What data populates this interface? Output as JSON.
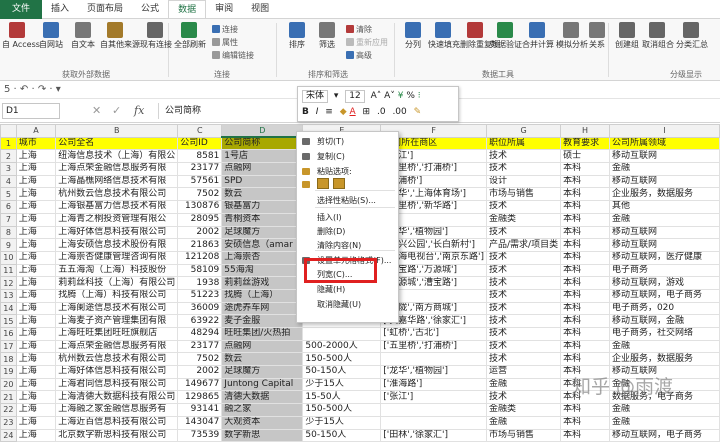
{
  "tabs": [
    "文件",
    "插入",
    "页面布局",
    "公式",
    "数据",
    "审阅",
    "视图"
  ],
  "ribbon": {
    "buttons": [
      {
        "label": "自 Access",
        "name": "from-access",
        "color": "#b33a3a"
      },
      {
        "label": "自网站",
        "name": "from-web",
        "color": "#3a6fb3"
      },
      {
        "label": "自文本",
        "name": "from-text",
        "color": "#777777"
      },
      {
        "label": "自其他来源",
        "name": "from-other",
        "color": "#a37a2a"
      },
      {
        "label": "现有连接",
        "name": "existing-connections",
        "color": "#666666"
      },
      {
        "label": "全部刷新",
        "name": "refresh-all",
        "color": "#2a8a4a"
      },
      {
        "label": "排序",
        "name": "sort",
        "color": "#3a6fb3"
      },
      {
        "label": "筛选",
        "name": "filter",
        "color": "#777777"
      },
      {
        "label": "分列",
        "name": "text-to-columns",
        "color": "#3a6fb3"
      },
      {
        "label": "快速填充",
        "name": "flash-fill",
        "color": "#3a6fb3"
      },
      {
        "label": "删除重复项",
        "name": "remove-duplicates",
        "color": "#b33a3a"
      },
      {
        "label": "数据验证",
        "name": "data-validation",
        "color": "#2a8a4a"
      },
      {
        "label": "合并计算",
        "name": "consolidate",
        "color": "#3a6fb3"
      },
      {
        "label": "模拟分析",
        "name": "what-if",
        "color": "#777777"
      },
      {
        "label": "关系",
        "name": "relationships",
        "color": "#777777"
      },
      {
        "label": "创建组",
        "name": "group",
        "color": "#666666"
      },
      {
        "label": "取消组合",
        "name": "ungroup",
        "color": "#666666"
      },
      {
        "label": "分类汇总",
        "name": "subtotal",
        "color": "#666666"
      }
    ],
    "small": [
      "连接",
      "属性",
      "编辑链接",
      "清除",
      "重新应用",
      "高级"
    ],
    "groups": [
      "获取外部数据",
      "连接",
      "排序和筛选",
      "数据工具",
      "分级显示"
    ]
  },
  "quick_access": "5 · ↶ · ↷ · ▾",
  "formula_bar": {
    "name_box": "D1",
    "value": "公司简称"
  },
  "columns": [
    "A",
    "B",
    "C",
    "D",
    "E",
    "F",
    "G",
    "H",
    "I"
  ],
  "rows": [
    [
      "城市",
      "公司全名",
      "公司ID",
      "公司简称",
      "",
      "公司所在商区",
      "职位所属",
      "教育要求",
      "公司所属领域"
    ],
    [
      "上海",
      "纽海信息技术（上海）有限公",
      "8581",
      "1号店",
      "",
      "['张江']",
      "技术",
      "硕士",
      "移动互联网"
    ],
    [
      "上海",
      "上海点荣金融信息服务有限",
      "23177",
      "点融网",
      "",
      "['五里桥','打浦桥']",
      "技术",
      "本科",
      "金融"
    ],
    [
      "上海",
      "上海晶樵网络信息技术有限",
      "57561",
      "SPD",
      "",
      "['打浦桥']",
      "设计",
      "本科",
      "移动互联网"
    ],
    [
      "上海",
      "杭州数云信息技术有限公司",
      "7502",
      "数云",
      "",
      "['龙华','上海体育场']",
      "市场与销售",
      "本科",
      "企业服务，数据服务"
    ],
    [
      "上海",
      "上海银基富力信息技术有限",
      "130876",
      "银基富力",
      "",
      "['五里桥','新华路']",
      "技术",
      "本科",
      "其他"
    ],
    [
      "上海",
      "上海青之桐投资管理有限公",
      "28095",
      "青桐资本",
      "",
      "",
      "金融类",
      "本科",
      "金融"
    ],
    [
      "上海",
      "上海好体信息科技有限公司",
      "2002",
      "足球魔方",
      "",
      "['龙华','植物园']",
      "技术",
      "本科",
      "移动互联网"
    ],
    [
      "上海",
      "上海安硕信息技术股份有限",
      "21863",
      "安硕信息（amar",
      "",
      "['黄兴公园','长白新村']",
      "产品/需求/项目类",
      "本科",
      "移动互联网"
    ],
    [
      "上海",
      "上海崇杏健康管理咨询有限",
      "121208",
      "上海崇杏",
      "",
      "['上海电视台','南京东路']",
      "技术",
      "本科",
      "移动互联网，医疗健康"
    ],
    [
      "上海",
      "五五海淘（上海）科技股份",
      "58109",
      "55海淘",
      "",
      "['漕宝路','万源城']",
      "技术",
      "本科",
      "电子商务"
    ],
    [
      "上海",
      "莉莉丝科技（上海）有限公司",
      "1938",
      "莉莉丝游戏",
      "",
      "['万源城','漕宝路']",
      "技术",
      "本科",
      "移动互联网，游戏"
    ],
    [
      "上海",
      "找腾（上海）科技有限公司",
      "51223",
      "找腾（上海）",
      "",
      "",
      "技术",
      "本科",
      "移动互联网，电子商务"
    ],
    [
      "上海",
      "上海阑途信息技术有限公司",
      "36009",
      "途虎养车网",
      "",
      "['梅陇','南方商城']",
      "技术",
      "本科",
      "电子商务，020"
    ],
    [
      "上海",
      "上海麦子资产管理集团有限",
      "63922",
      "麦子金服",
      "",
      "['黄嘉华路','徐家汇']",
      "技术",
      "本科",
      "移动互联网，金融"
    ],
    [
      "上海",
      "上海旺旺集团旺旺旗舰店",
      "48294",
      "旺旺集团/火热拍",
      "",
      "['虹桥','古北']",
      "技术",
      "本科",
      "电子商务，社交网络"
    ],
    [
      "上海",
      "上海点荣金融信息服务有限",
      "23177",
      "点融网",
      "500-2000人",
      "['五里桥','打浦桥']",
      "技术",
      "本科",
      "金融"
    ],
    [
      "上海",
      "杭州数云信息技术有限公司",
      "7502",
      "数云",
      "150-500人",
      "",
      "技术",
      "本科",
      "企业服务，数据服务"
    ],
    [
      "上海",
      "上海好体信息科技有限公司",
      "2002",
      "足球魔方",
      "50-150人",
      "['龙华','植物园']",
      "运营",
      "本科",
      "移动互联网"
    ],
    [
      "上海",
      "上海君同信息科技有限公司",
      "149677",
      "Juntong Capital",
      "少于15人",
      "['淮海路']",
      "金融",
      "本科",
      "金融"
    ],
    [
      "上海",
      "上海清德大数据科技有限公司",
      "129865",
      "清德大数据",
      "15-50人",
      "['张江']",
      "技术",
      "本科",
      "数据服务，电子商务"
    ],
    [
      "上海",
      "上海融之家金融信息服务有",
      "93141",
      "融之家",
      "150-500人",
      "",
      "金融类",
      "本科",
      "金融"
    ],
    [
      "上海",
      "上海近百信息科技有限公司",
      "143047",
      "大观资本",
      "少于15人",
      "",
      "金融",
      "本科",
      "金融"
    ],
    [
      "上海",
      "北京数字新思科技有限公司",
      "73539",
      "数字新思",
      "50-150人",
      "['田林','徐家汇']",
      "市场与销售",
      "本科",
      "移动互联网，电子商务"
    ]
  ],
  "mini_toolbar": {
    "font": "宋体",
    "size": "12"
  },
  "context_menu": [
    {
      "label": "剪切(T)",
      "name": "cut",
      "color": "#6a6a6a"
    },
    {
      "label": "复制(C)",
      "name": "copy",
      "color": "#6a6a6a"
    },
    {
      "label": "粘贴选项:",
      "name": "paste-options",
      "color": "#c8962a"
    },
    {
      "label": "",
      "name": "paste-icons",
      "color": "#c8962a"
    },
    {
      "label": "选择性粘贴(S)...",
      "name": "paste-special",
      "color": ""
    },
    {
      "label": "插入(I)",
      "name": "insert",
      "color": ""
    },
    {
      "label": "删除(D)",
      "name": "delete",
      "color": ""
    },
    {
      "label": "清除内容(N)",
      "name": "clear-contents",
      "color": ""
    },
    {
      "label": "设置单元格格式(F)...",
      "name": "format-cells",
      "color": "#6a6a6a"
    },
    {
      "label": "列宽(C)...",
      "name": "column-width",
      "color": ""
    },
    {
      "label": "隐藏(H)",
      "name": "hide",
      "color": ""
    },
    {
      "label": "取消隐藏(U)",
      "name": "unhide",
      "color": ""
    }
  ],
  "watermark": "知乎 @雨渡"
}
